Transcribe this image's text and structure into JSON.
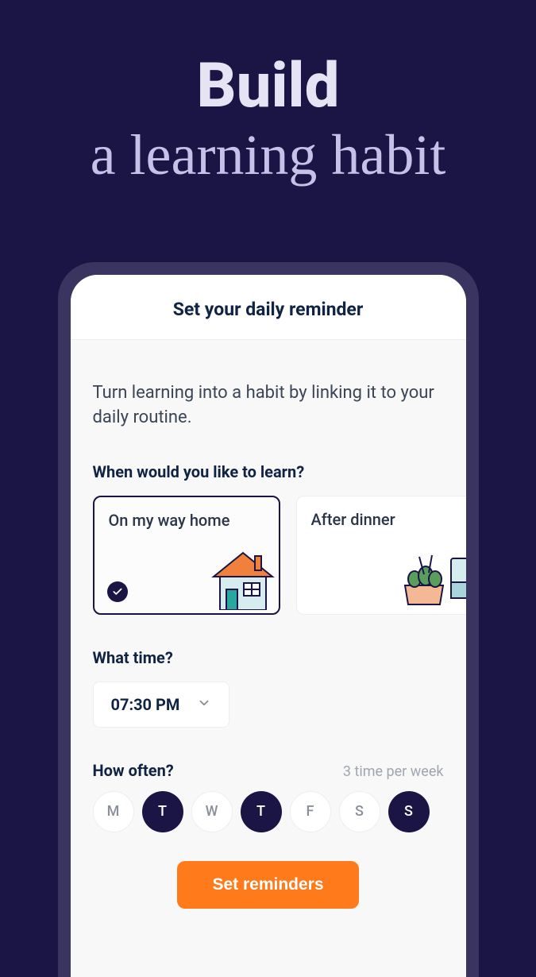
{
  "headline": {
    "bold": "Build",
    "serif": "a learning habit"
  },
  "screen": {
    "title": "Set your daily reminder",
    "intro": "Turn learning into a habit by linking it to your daily routine.",
    "when_label": "When would you like to learn?",
    "routines": [
      {
        "label": "On my way home",
        "selected": true
      },
      {
        "label": "After dinner",
        "selected": false
      }
    ],
    "time_label": "What time?",
    "time_value": "07:30 PM",
    "often_label": "How often?",
    "often_hint": "3 time per week",
    "days": [
      {
        "letter": "M",
        "on": false
      },
      {
        "letter": "T",
        "on": true
      },
      {
        "letter": "W",
        "on": false
      },
      {
        "letter": "T",
        "on": true
      },
      {
        "letter": "F",
        "on": false
      },
      {
        "letter": "S",
        "on": false
      },
      {
        "letter": "S",
        "on": true
      }
    ],
    "cta": "Set reminders"
  }
}
